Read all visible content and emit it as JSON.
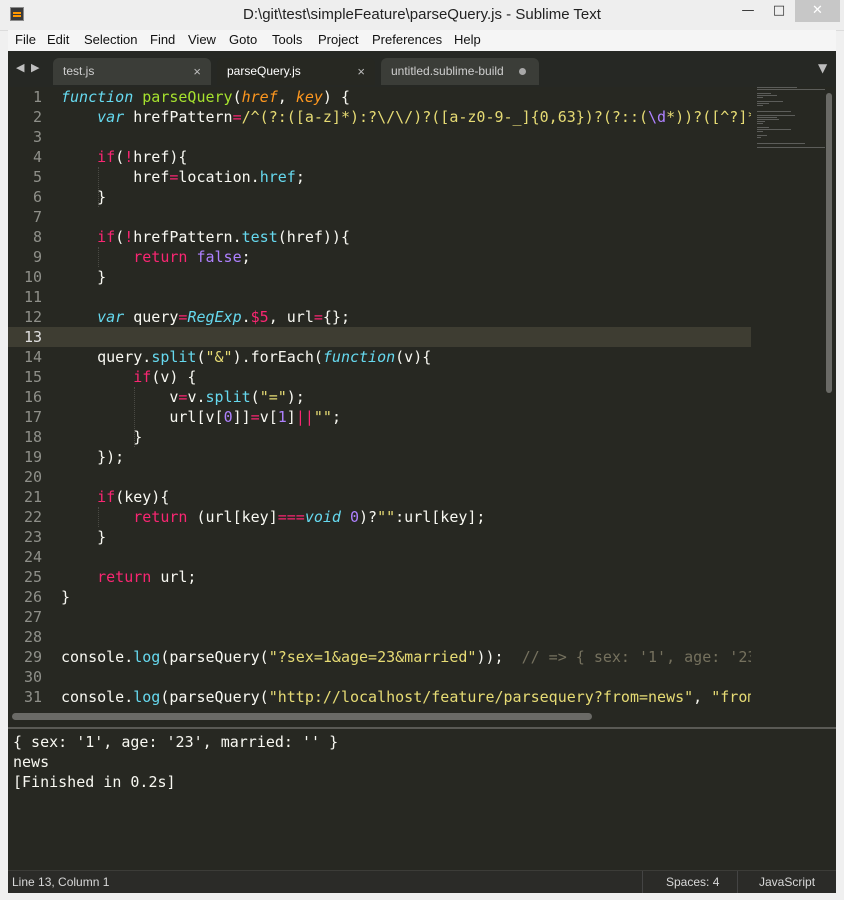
{
  "window": {
    "title": "D:\\git\\test\\simpleFeature\\parseQuery.js - Sublime Text",
    "minimize": "—",
    "maximize": "□",
    "close": "✕"
  },
  "menu": [
    "File",
    "Edit",
    "Selection",
    "Find",
    "View",
    "Goto",
    "Tools",
    "Project",
    "Preferences",
    "Help"
  ],
  "tabs": [
    {
      "label": "test.js",
      "close": "×"
    },
    {
      "label": "parseQuery.js",
      "close": "×"
    },
    {
      "label": "untitled.sublime-build"
    }
  ],
  "nav": {
    "back": "◀",
    "forward": "▶",
    "dropdown": "▼"
  },
  "editor": {
    "current_line": 13,
    "line_numbers": [
      "1",
      "2",
      "3",
      "4",
      "5",
      "6",
      "7",
      "8",
      "9",
      "10",
      "11",
      "12",
      "13",
      "14",
      "15",
      "16",
      "17",
      "18",
      "19",
      "20",
      "21",
      "22",
      "23",
      "24",
      "25",
      "26",
      "27",
      "28",
      "29",
      "30",
      "31"
    ]
  },
  "output": [
    "{ sex: '1', age: '23', married: '' }",
    "news",
    "[Finished in 0.2s]"
  ],
  "status": {
    "position": "Line 13, Column 1",
    "spaces": "Spaces: 4",
    "syntax": "JavaScript"
  },
  "theme": {
    "background": "#272822",
    "keyword": "#f92672",
    "storage": "#66d9ef",
    "function": "#a6e22e",
    "param": "#fd971f",
    "string": "#e6db74",
    "number": "#ae81ff",
    "comment": "#75715e"
  }
}
